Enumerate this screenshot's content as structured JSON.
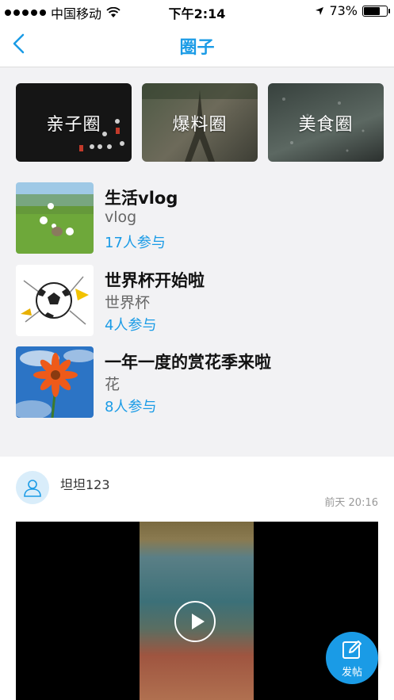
{
  "status_bar": {
    "carrier": "中国移动",
    "time": "下午2:14",
    "battery": "73%"
  },
  "nav": {
    "title": "圈子"
  },
  "circles": [
    {
      "label": "亲子圈"
    },
    {
      "label": "爆料圈"
    },
    {
      "label": "美食圈"
    }
  ],
  "topics": [
    {
      "title": "生活vlog",
      "subtitle": "vlog",
      "participants": "17人参与"
    },
    {
      "title": "世界杯开始啦",
      "subtitle": "世界杯",
      "participants": "4人参与"
    },
    {
      "title": "一年一度的赏花季来啦",
      "subtitle": "花",
      "participants": "8人参与"
    }
  ],
  "post": {
    "username": "坦坦123",
    "time": "前天 20:16"
  },
  "fab": {
    "label": "发帖"
  },
  "colors": {
    "accent": "#1a9be6"
  }
}
